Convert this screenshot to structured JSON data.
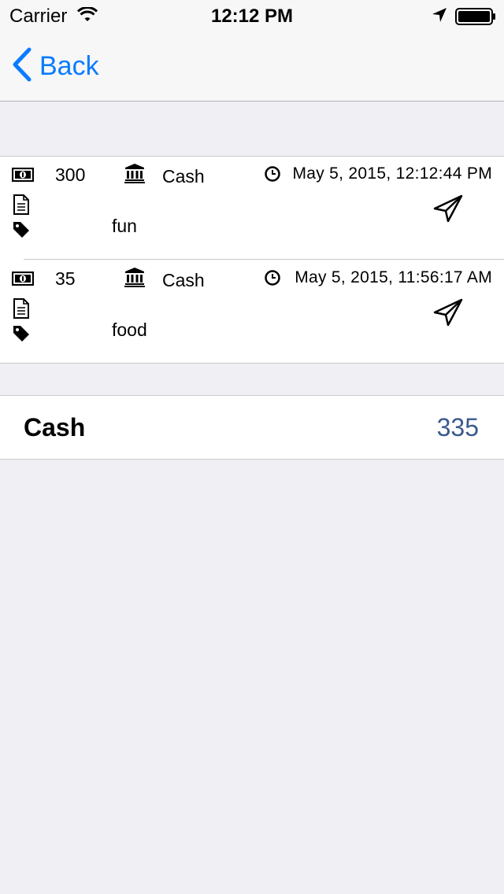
{
  "status_bar": {
    "carrier": "Carrier",
    "time": "12:12 PM",
    "icons": [
      "wifi-icon",
      "location-arrow-icon",
      "battery-icon"
    ]
  },
  "nav": {
    "back_label": "Back",
    "accent_color": "#0a7cff"
  },
  "transactions": [
    {
      "amount": "300",
      "account": "Cash",
      "datetime": "May 5, 2015, 12:12:44 PM",
      "tag": "fun",
      "icons": [
        "money-icon",
        "bank-icon",
        "clock-icon",
        "document-icon",
        "tag-icon",
        "send-icon"
      ]
    },
    {
      "amount": "35",
      "account": "Cash",
      "datetime": "May 5, 2015, 11:56:17 AM",
      "tag": "food",
      "icons": [
        "money-icon",
        "bank-icon",
        "clock-icon",
        "document-icon",
        "tag-icon",
        "send-icon"
      ]
    }
  ],
  "summary": {
    "label": "Cash",
    "value": "335",
    "value_color": "#3b5a8f"
  }
}
